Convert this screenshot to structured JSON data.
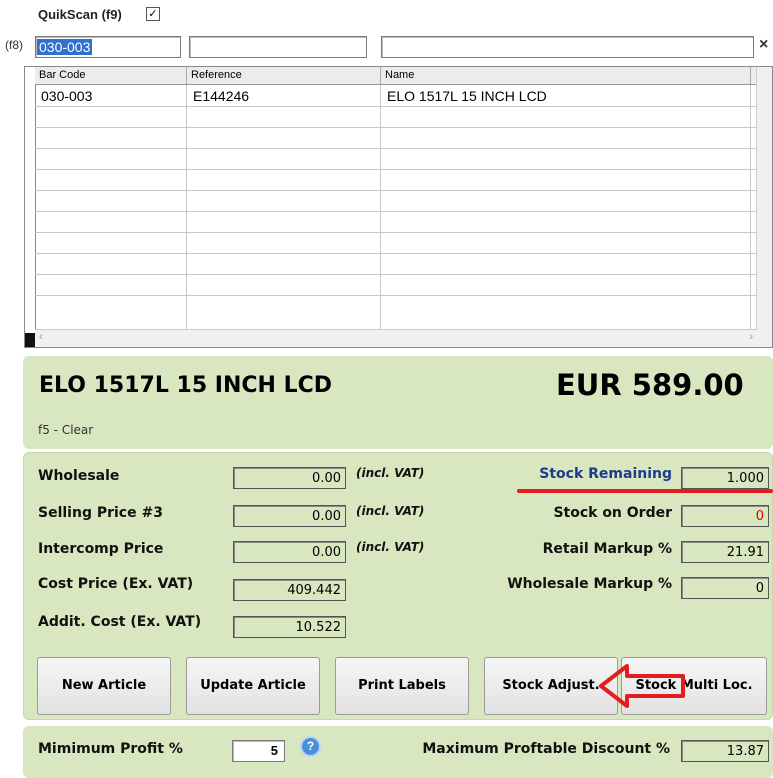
{
  "search": {
    "quikscan_label": "QuikScan (f9)",
    "quikscan_checked": "✓",
    "f8_label": "(f8)",
    "barcode_value": "030-003",
    "reference_value": "",
    "name_value": "",
    "close_glyph": "×"
  },
  "grid": {
    "columns": [
      "Bar Code",
      "Reference",
      "Name"
    ],
    "rows": [
      [
        "030-003",
        "E144246",
        "ELO 1517L 15 INCH LCD"
      ]
    ],
    "scroll_left_glyph": "‹",
    "scroll_right_glyph": "›"
  },
  "article": {
    "name": "ELO 1517L 15 INCH LCD",
    "price": "EUR 589.00",
    "clear_hint": "f5 - Clear"
  },
  "details": {
    "wholesale_label": "Wholesale",
    "wholesale_value": "0.00",
    "selling_label": "Selling Price #3",
    "selling_value": "0.00",
    "intercomp_label": "Intercomp Price",
    "intercomp_value": "0.00",
    "cost_label": "Cost Price (Ex. VAT)",
    "cost_value": "409.442",
    "addit_label": "Addit. Cost (Ex. VAT)",
    "addit_value": "10.522",
    "incl_vat": "(incl. VAT)",
    "stock_remaining_label": "Stock Remaining",
    "stock_remaining_value": "1.000",
    "stock_order_label": "Stock on Order",
    "stock_order_value": "0",
    "retail_markup_label": "Retail Markup %",
    "retail_markup_value": "21.91",
    "wholesale_markup_label": "Wholesale Markup %",
    "wholesale_markup_value": "0"
  },
  "buttons": {
    "new_article": "New Article",
    "update_article": "Update Article",
    "print_labels": "Print Labels",
    "stock_adjust": "Stock Adjust.",
    "stock_multi": "Stock Multi Loc."
  },
  "bottom": {
    "min_profit_label": "Mimimum  Profit  %",
    "min_profit_value": "5",
    "help_glyph": "?",
    "max_discount_label": "Maximum Proftable Discount %",
    "max_discount_value": "13.87"
  },
  "colors": {
    "panel_green": "#d8e7bf",
    "annotation_red": "#e31e1e",
    "stock_remaining_blue": "#1f3a8a",
    "value_red": "#e00000"
  }
}
